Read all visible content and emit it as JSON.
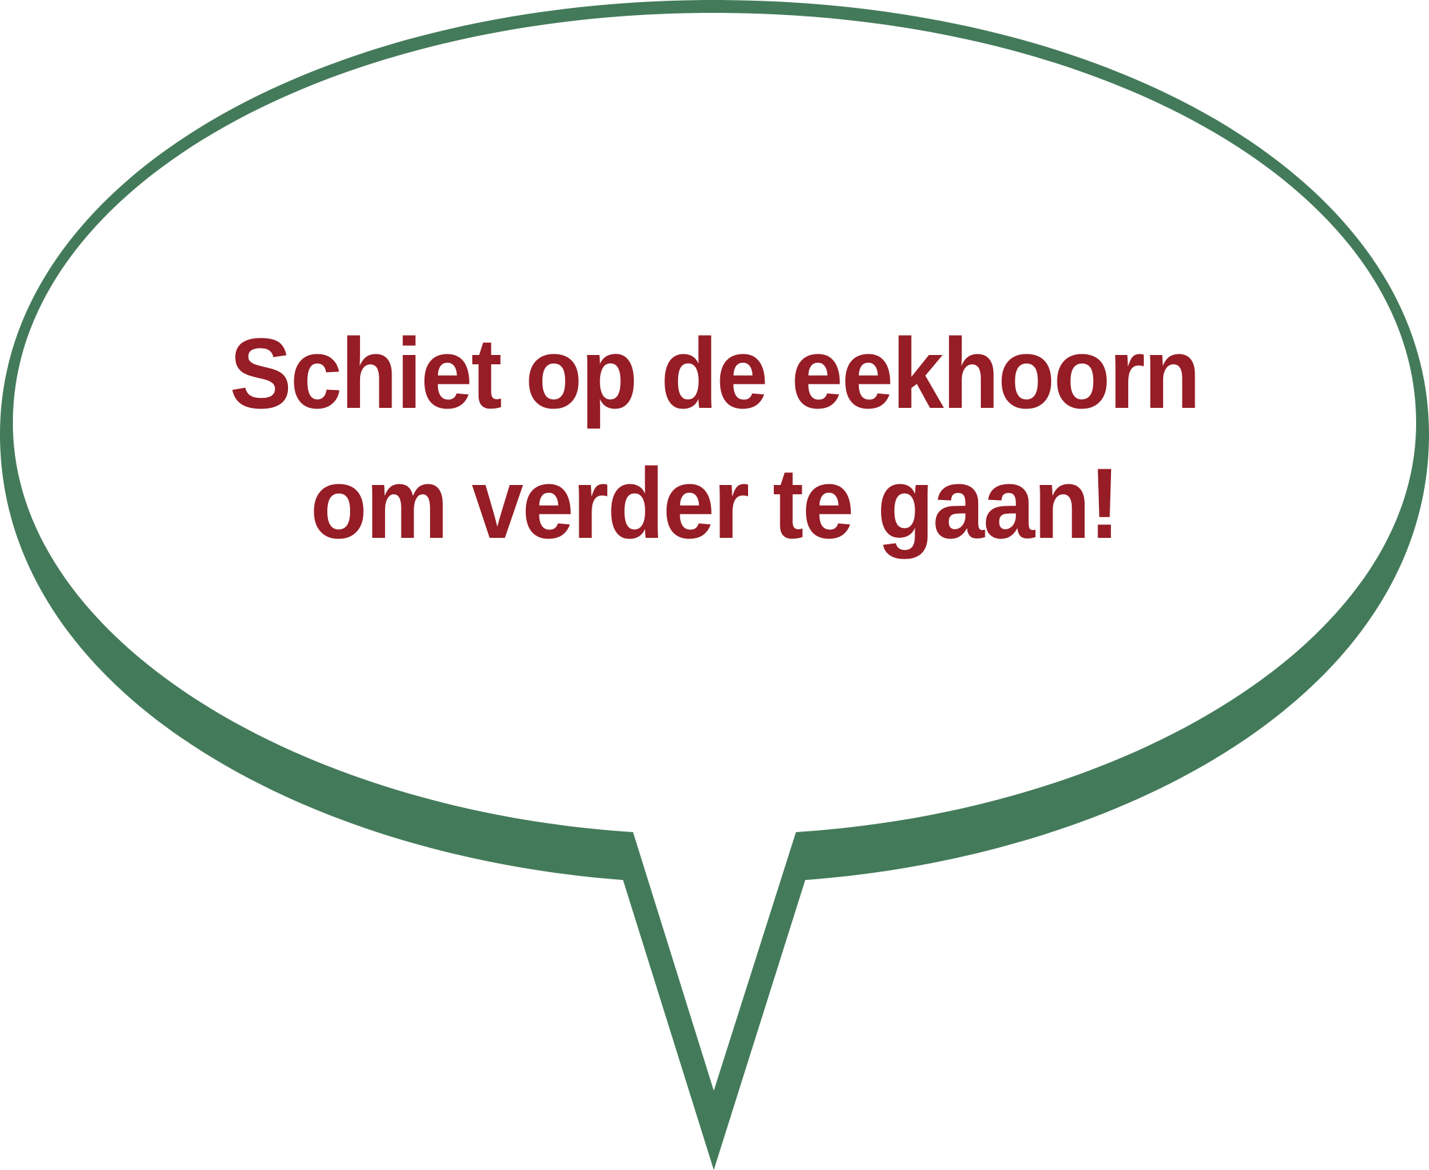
{
  "speech_bubble": {
    "text_lines": [
      "Schiet op de eekhoorn",
      "om verder te gaan!"
    ],
    "colors": {
      "outline": "#437a5a",
      "fill": "#ffffff",
      "text": "#961c25"
    }
  }
}
